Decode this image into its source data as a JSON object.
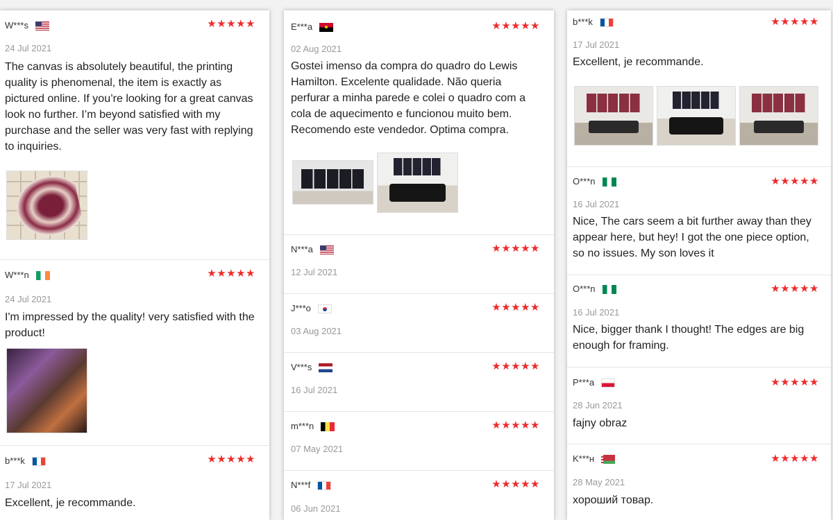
{
  "stars": "★★★★★",
  "columns": [
    {
      "reviews": [
        {
          "name": "W***s",
          "flag": "us",
          "date": "24 Jul 2021",
          "text": "The canvas is absolutely beautiful, the printing quality is phenomenal, the item is exactly as pictured online. If you’re looking for a great canvas look no further. I’m beyond satisfied with my purchase and the seller was very fast with replying to inquiries."
        },
        {
          "name": "W***n",
          "flag": "ie",
          "date": "24 Jul 2021",
          "text": "I'm impressed by the quality! very satisfied with the product!"
        },
        {
          "name": "b***k",
          "flag": "fr",
          "date": "17 Jul 2021",
          "text": "Excellent, je recommande."
        }
      ]
    },
    {
      "reviews": [
        {
          "name": "E***a",
          "flag": "ao",
          "date": "02 Aug 2021",
          "text": "Gostei imenso da compra do quadro do Lewis Hamilton. Excelente qualidade. Não queria perfurar a minha parede e colei o quadro com a cola de aquecimento e funcionou muito bem. Recomendo este vendedor. Optima compra."
        },
        {
          "name": "N***a",
          "flag": "us",
          "date": "12 Jul 2021",
          "text": ""
        },
        {
          "name": "J***o",
          "flag": "kr",
          "date": "03 Aug 2021",
          "text": ""
        },
        {
          "name": "V***s",
          "flag": "nl",
          "date": "16 Jul 2021",
          "text": ""
        },
        {
          "name": "m***n",
          "flag": "be",
          "date": "07 May 2021",
          "text": ""
        },
        {
          "name": "N***f",
          "flag": "fr",
          "date": "06 Jun 2021",
          "text": ""
        }
      ]
    },
    {
      "reviews": [
        {
          "name": "b***k",
          "flag": "fr",
          "date": "17 Jul 2021",
          "text": "Excellent, je recommande."
        },
        {
          "name": "O***n",
          "flag": "ng",
          "date": "16 Jul 2021",
          "text": "Nice, The cars seem a bit further away than they appear here, but hey! I got the one piece option, so no issues. My son loves it"
        },
        {
          "name": "O***n",
          "flag": "ng",
          "date": "16 Jul 2021",
          "text": "Nice, bigger thank I thought! The edges are big enough for framing."
        },
        {
          "name": "P***a",
          "flag": "pl",
          "date": "28 Jun 2021",
          "text": "fajny obraz"
        },
        {
          "name": "K***н",
          "flag": "by",
          "date": "28 May 2021",
          "text": "хороший товар."
        }
      ]
    }
  ],
  "colors": {
    "star": "#ee2b2b",
    "date": "#999999",
    "divider": "#e6e6e6"
  }
}
